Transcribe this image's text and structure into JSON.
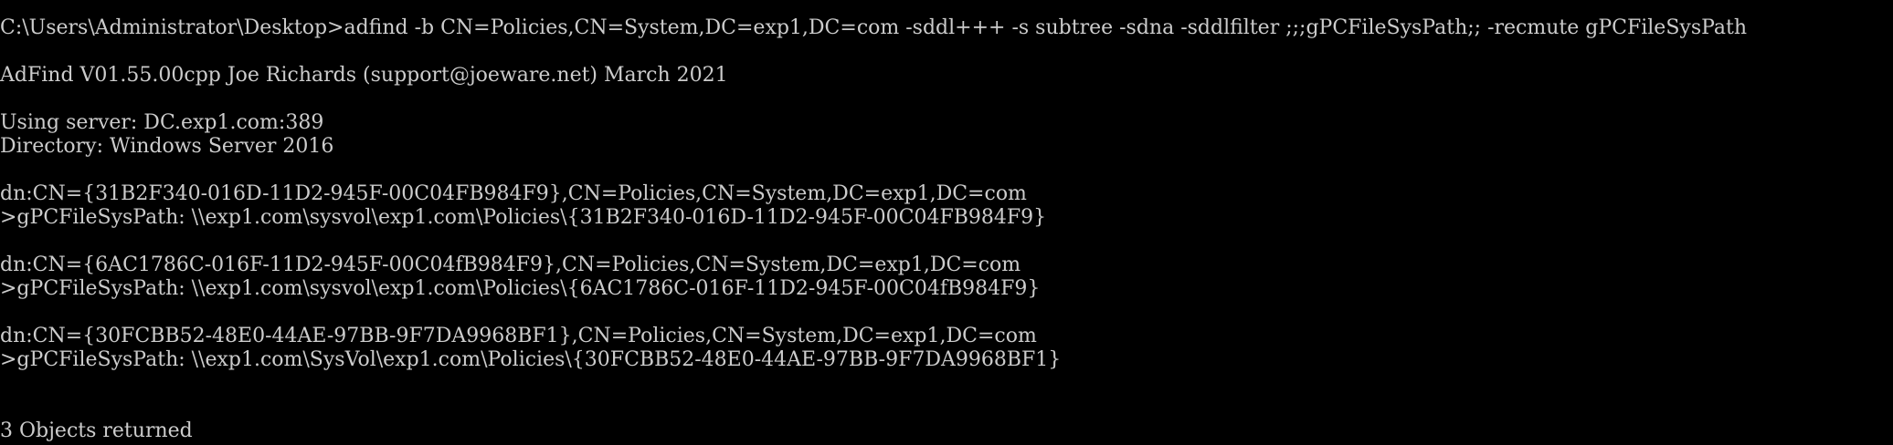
{
  "console": {
    "lines": [
      "C:\\Users\\Administrator\\Desktop>adfind -b CN=Policies,CN=System,DC=exp1,DC=com -sddl+++ -s subtree -sdna -sddlfilter ;;;gPCFileSysPath;; -recmute gPCFileSysPath",
      "",
      "AdFind V01.55.00cpp Joe Richards (support@joeware.net) March 2021",
      "",
      "Using server: DC.exp1.com:389",
      "Directory: Windows Server 2016",
      "",
      "dn:CN={31B2F340-016D-11D2-945F-00C04FB984F9},CN=Policies,CN=System,DC=exp1,DC=com",
      ">gPCFileSysPath: \\\\exp1.com\\sysvol\\exp1.com\\Policies\\{31B2F340-016D-11D2-945F-00C04FB984F9}",
      "",
      "dn:CN={6AC1786C-016F-11D2-945F-00C04fB984F9},CN=Policies,CN=System,DC=exp1,DC=com",
      ">gPCFileSysPath: \\\\exp1.com\\sysvol\\exp1.com\\Policies\\{6AC1786C-016F-11D2-945F-00C04fB984F9}",
      "",
      "dn:CN={30FCBB52-48E0-44AE-97BB-9F7DA9968BF1},CN=Policies,CN=System,DC=exp1,DC=com",
      ">gPCFileSysPath: \\\\exp1.com\\SysVol\\exp1.com\\Policies\\{30FCBB52-48E0-44AE-97BB-9F7DA9968BF1}",
      "",
      "",
      "3 Objects returned"
    ]
  },
  "colors": {
    "background": "#000000",
    "text": "#CCCCCC"
  }
}
